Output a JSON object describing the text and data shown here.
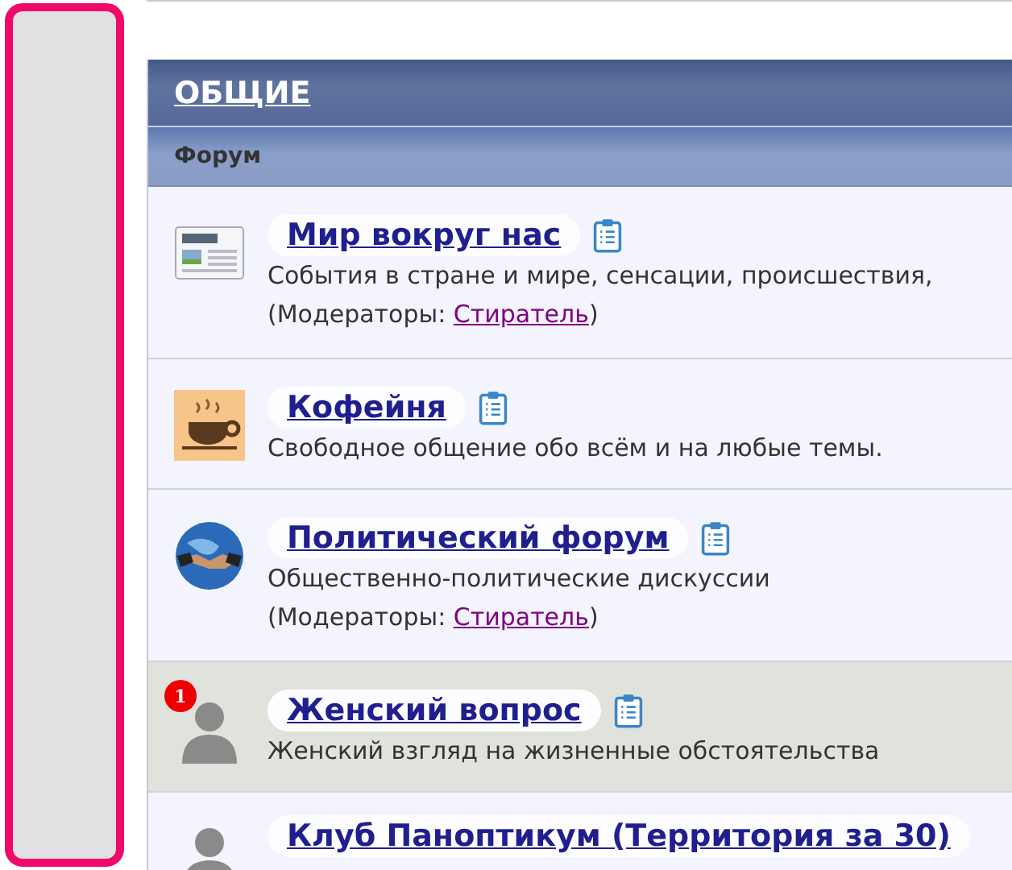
{
  "category": {
    "title": "ОБЩИЕ",
    "column_header": "Форум"
  },
  "forums": [
    {
      "title": "Мир вокруг нас",
      "description": "События в стране и мире, сенсации, происшествия,",
      "moderators_label": "(Модераторы: ",
      "moderator": "Стиратель",
      "moderators_end": ")",
      "highlighted": false
    },
    {
      "title": "Кофейня",
      "description": "Свободное общение обо всём и на любые темы.",
      "highlighted": false
    },
    {
      "title": "Политический форум",
      "description": "Общественно-политические дискуссии",
      "moderators_label": "(Модераторы: ",
      "moderator": "Стиратель",
      "moderators_end": ")",
      "highlighted": false
    },
    {
      "title": "Женский вопрос",
      "description": "Женский взгляд на жизненные обстоятельства",
      "badge": "1",
      "highlighted": true
    },
    {
      "title": "Клуб Паноптикум (Территория за 30)",
      "highlighted": false
    }
  ]
}
